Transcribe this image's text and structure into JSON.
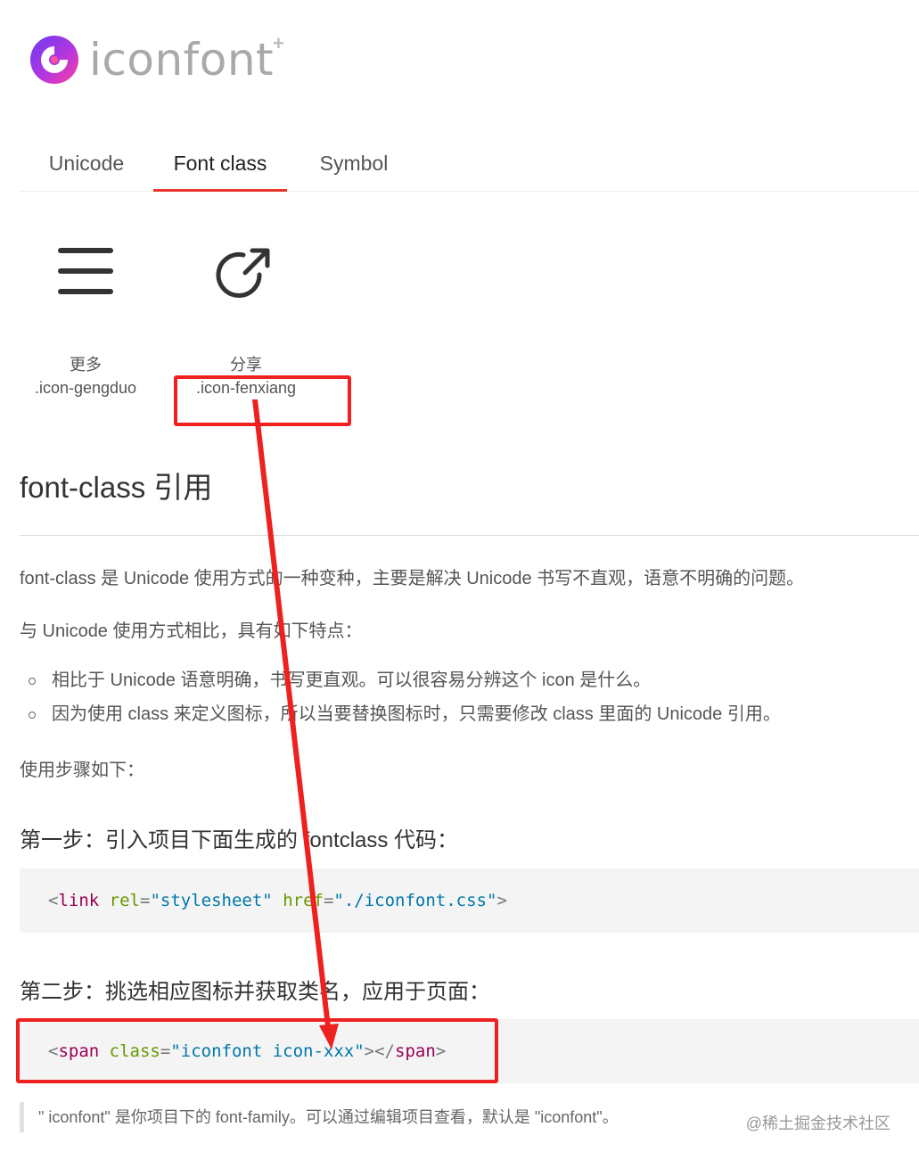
{
  "logo": {
    "text": "iconfont",
    "plus": "+"
  },
  "tabs": [
    {
      "label": "Unicode",
      "active": false
    },
    {
      "label": "Font class",
      "active": true
    },
    {
      "label": "Symbol",
      "active": false
    }
  ],
  "icons": [
    {
      "name": "更多",
      "class": ".icon-gengduo",
      "icon": "hamburger-menu-icon"
    },
    {
      "name": "分享",
      "class": ".icon-fenxiang",
      "icon": "share-icon"
    }
  ],
  "section_title": "font-class 引用",
  "paragraphs": {
    "intro": "font-class 是 Unicode 使用方式的一种变种，主要是解决 Unicode 书写不直观，语意不明确的问题。",
    "compare": "与 Unicode 使用方式相比，具有如下特点：",
    "steps_intro": "使用步骤如下："
  },
  "bullets": [
    "相比于 Unicode 语意明确，书写更直观。可以很容易分辨这个 icon 是什么。",
    "因为使用 class 来定义图标，所以当要替换图标时，只需要修改 class 里面的 Unicode 引用。"
  ],
  "step1": {
    "title": "第一步：引入项目下面生成的 fontclass 代码：",
    "code": {
      "open": "<",
      "tag": "link",
      "attr1": "rel",
      "eq1": "=",
      "val1": "\"stylesheet\"",
      "attr2": "href",
      "eq2": "=",
      "val2": "\"./iconfont.css\"",
      "close": ">"
    }
  },
  "step2": {
    "title": "第二步：挑选相应图标并获取类名，应用于页面：",
    "code": {
      "open": "<",
      "tag": "span",
      "attr1": "class",
      "eq1": "=",
      "val1": "\"iconfont icon-xxx\"",
      "mid": "></",
      "tag2": "span",
      "close": ">"
    }
  },
  "note": "\" iconfont\" 是你项目下的 font-family。可以通过编辑项目查看，默认是 \"iconfont\"。",
  "watermark": "@稀土掘金技术社区",
  "colors": {
    "accent": "#e8352b",
    "annotation": "#ef2020"
  }
}
